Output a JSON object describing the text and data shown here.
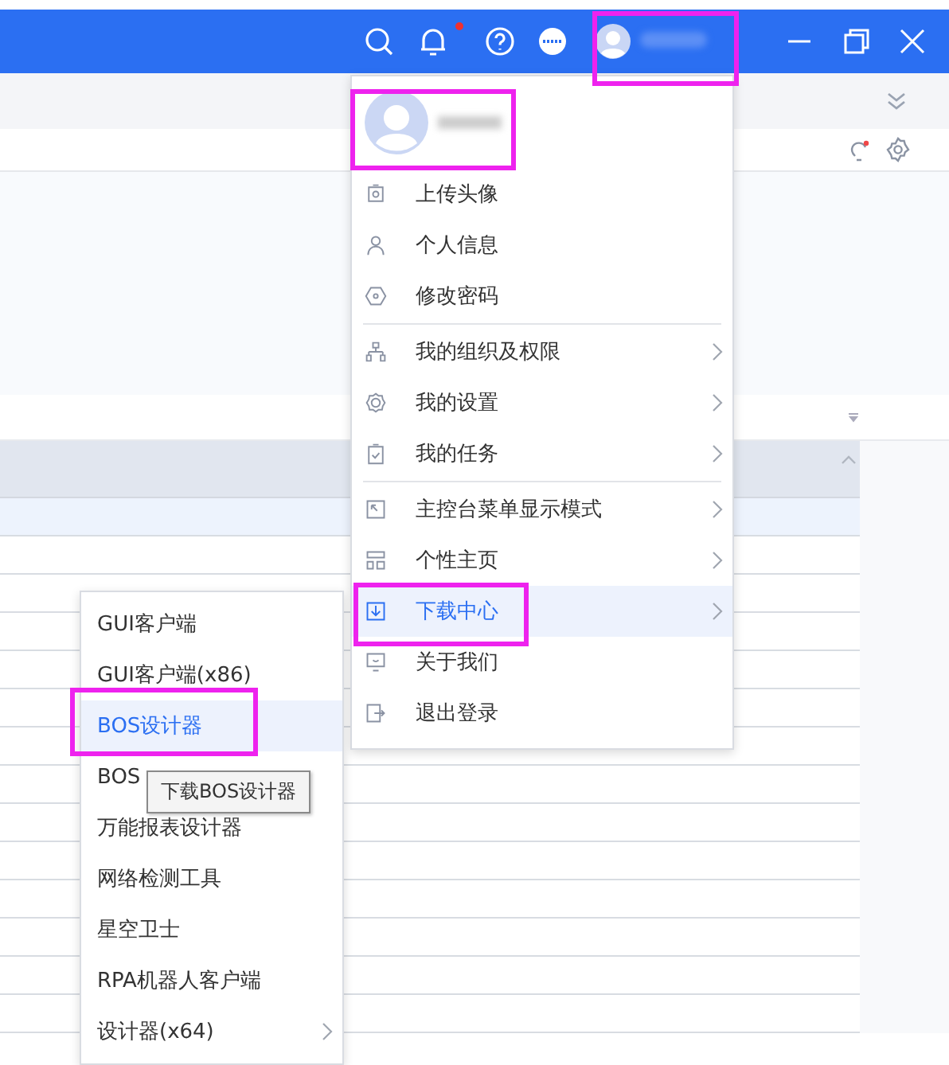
{
  "topbar": {
    "bell_unread": true
  },
  "user_menu": {
    "groups": [
      [
        {
          "label": "上传头像",
          "submenu": false,
          "selected": false
        },
        {
          "label": "个人信息",
          "submenu": false,
          "selected": false
        },
        {
          "label": "修改密码",
          "submenu": false,
          "selected": false
        }
      ],
      [
        {
          "label": "我的组织及权限",
          "submenu": true,
          "selected": false
        },
        {
          "label": "我的设置",
          "submenu": true,
          "selected": false
        },
        {
          "label": "我的任务",
          "submenu": true,
          "selected": false
        }
      ],
      [
        {
          "label": "主控台菜单显示模式",
          "submenu": true,
          "selected": false
        },
        {
          "label": "个性主页",
          "submenu": true,
          "selected": false
        },
        {
          "label": "下载中心",
          "submenu": true,
          "selected": true
        },
        {
          "label": "关于我们",
          "submenu": false,
          "selected": false
        },
        {
          "label": "退出登录",
          "submenu": false,
          "selected": false
        }
      ]
    ]
  },
  "download_menu": {
    "items": [
      {
        "label": "GUI客户端",
        "submenu": false,
        "selected": false
      },
      {
        "label": "GUI客户端(x86)",
        "submenu": false,
        "selected": false
      },
      {
        "label": "BOS设计器",
        "submenu": false,
        "selected": true
      },
      {
        "label": "BOS",
        "submenu": false,
        "selected": false
      },
      {
        "label": "万能报表设计器",
        "submenu": false,
        "selected": false
      },
      {
        "label": "网络检测工具",
        "submenu": false,
        "selected": false
      },
      {
        "label": "星空卫士",
        "submenu": false,
        "selected": false
      },
      {
        "label": "RPA机器人客户端",
        "submenu": false,
        "selected": false
      },
      {
        "label": "设计器(x64)",
        "submenu": true,
        "selected": false
      }
    ]
  },
  "tooltip": {
    "text": "下载BOS设计器"
  }
}
